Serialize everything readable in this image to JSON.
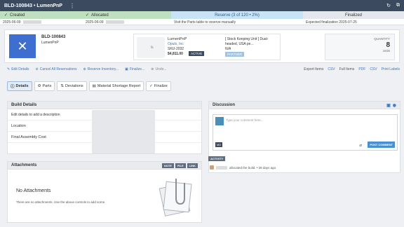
{
  "titlebar": {
    "title": "BLD-100843 • LumenPnP",
    "menu": "⋮",
    "icons": [
      "↻",
      "⧉"
    ]
  },
  "stages": [
    {
      "label": "Created",
      "done": true,
      "date": "2025-06-09"
    },
    {
      "label": "Allocated",
      "done": true,
      "date": "2025-06-09"
    },
    {
      "label": "Reserve (3 of 120 • 2%)",
      "done": false,
      "date": "Visit the Parts table to reserve manually"
    },
    {
      "label": "Finalized",
      "done": false,
      "date": "Expected finalization 2025-07-25"
    }
  ],
  "header": {
    "build_number": "BLD-100843",
    "build_sub": "LumenPnP",
    "part_name": "LumenPnP",
    "vendor": "Opulo, Inc",
    "sku": "SKU-2032",
    "price": "$4,811.00",
    "status_badge": "ACTIVE",
    "description": "[ Stock Keeping Unit ] Dual-headed, USA pe...",
    "description2": "N/A",
    "partner_badge": "PARTNER",
    "quantity_label": "QUANTITY",
    "quantity_value": "8",
    "quantity_unit": "Units"
  },
  "actions": {
    "edit": "Edit Details",
    "cancel": "Cancel All Reservations",
    "reserve": "Reserve Inventory...",
    "finalize": "Finalize...",
    "undo": "Undo...",
    "export_items": "Export Items",
    "csv": "CSV",
    "full_items": "Full Items",
    "pdf": "PDF",
    "csv2": "CSV",
    "print": "Print Labels"
  },
  "tabs": [
    "Details",
    "Parts",
    "Deviations",
    "Material Shortage Report",
    "Finalize"
  ],
  "build_details": {
    "title": "Build Details",
    "rows": [
      "Edit details to add a description",
      "Location",
      "Final Assembly Cost"
    ]
  },
  "attachments": {
    "title": "Attachments",
    "buttons": [
      "NOTE",
      "FILE",
      "LINK"
    ],
    "empty_title": "No Attachments",
    "empty_desc": "There are no attachments. Use the above controls to add some."
  },
  "discussion": {
    "title": "Discussion",
    "placeholder": "Type your comment here...",
    "md": "MD",
    "post": "POST COMMENT",
    "activity_btn": "ACTIVITY",
    "activity_text": "allocated the build. • 28 days ago"
  }
}
